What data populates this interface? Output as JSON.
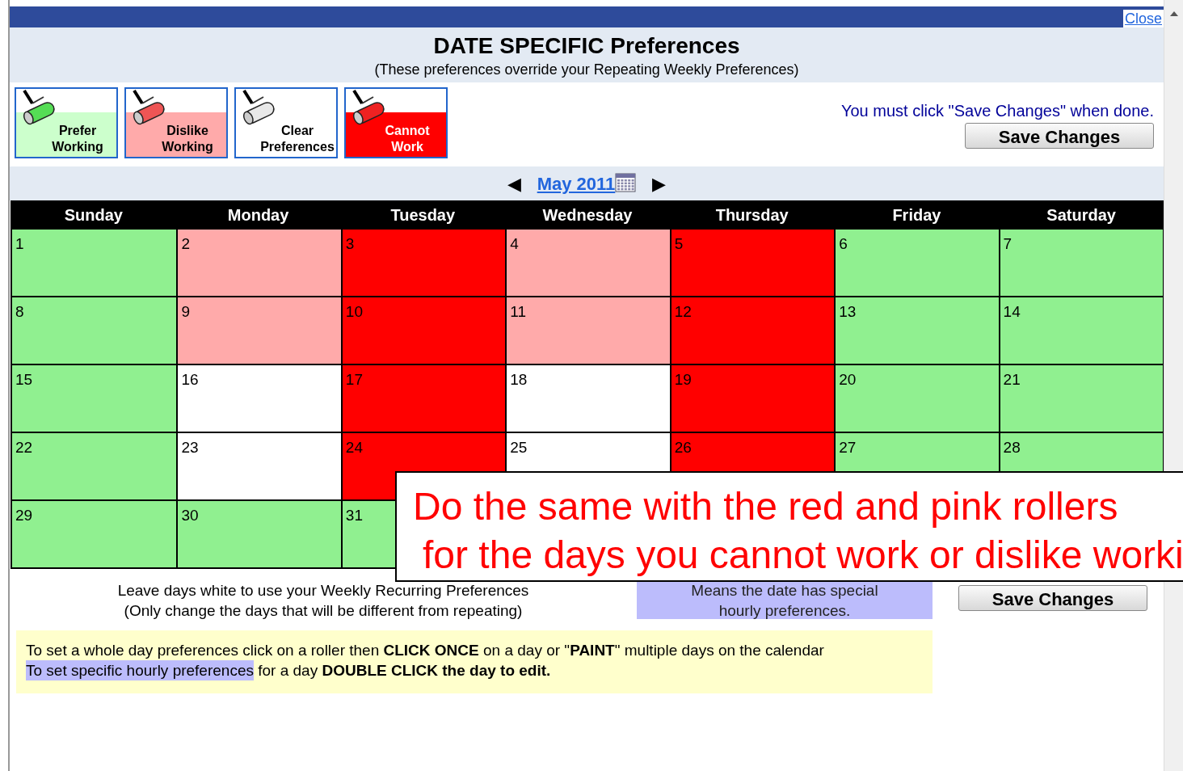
{
  "close_link": "Close",
  "title": "DATE SPECIFIC Preferences",
  "subtitle": "(These preferences override your Repeating Weekly Preferences)",
  "rollers": [
    {
      "kind": "prefer",
      "label": "Prefer Working"
    },
    {
      "kind": "dislike",
      "label": "Dislike Working"
    },
    {
      "kind": "clear",
      "label": "Clear Preferences"
    },
    {
      "kind": "cannot",
      "label": "Cannot Work"
    }
  ],
  "save_hint": "You must click \"Save Changes\" when done.",
  "save_button_top": "Save Changes",
  "month_nav": {
    "prev": "◀",
    "month": "May 2011",
    "next": "▶"
  },
  "weekdays": [
    "Sunday",
    "Monday",
    "Tuesday",
    "Wednesday",
    "Thursday",
    "Friday",
    "Saturday"
  ],
  "weeks": [
    [
      {
        "day": "1",
        "color": "#90f090"
      },
      {
        "day": "2",
        "color": "#ffaaaa"
      },
      {
        "day": "3",
        "color": "#ff0000"
      },
      {
        "day": "4",
        "color": "#ffaaaa"
      },
      {
        "day": "5",
        "color": "#ff0000"
      },
      {
        "day": "6",
        "color": "#90f090"
      },
      {
        "day": "7",
        "color": "#90f090"
      }
    ],
    [
      {
        "day": "8",
        "color": "#90f090"
      },
      {
        "day": "9",
        "color": "#ffaaaa"
      },
      {
        "day": "10",
        "color": "#ff0000"
      },
      {
        "day": "11",
        "color": "#ffaaaa"
      },
      {
        "day": "12",
        "color": "#ff0000"
      },
      {
        "day": "13",
        "color": "#90f090"
      },
      {
        "day": "14",
        "color": "#90f090"
      }
    ],
    [
      {
        "day": "15",
        "color": "#90f090"
      },
      {
        "day": "16",
        "color": "#ffffff"
      },
      {
        "day": "17",
        "color": "#ff0000"
      },
      {
        "day": "18",
        "color": "#ffffff"
      },
      {
        "day": "19",
        "color": "#ff0000"
      },
      {
        "day": "20",
        "color": "#90f090"
      },
      {
        "day": "21",
        "color": "#90f090"
      }
    ],
    [
      {
        "day": "22",
        "color": "#90f090"
      },
      {
        "day": "23",
        "color": "#ffffff"
      },
      {
        "day": "24",
        "color": "#ff0000"
      },
      {
        "day": "25",
        "color": "#ffffff"
      },
      {
        "day": "26",
        "color": "#ff0000"
      },
      {
        "day": "27",
        "color": "#90f090"
      },
      {
        "day": "28",
        "color": "#90f090"
      }
    ],
    [
      {
        "day": "29",
        "color": "#90f090"
      },
      {
        "day": "30",
        "color": "#90f090"
      },
      {
        "day": "31",
        "color": "#90f090"
      }
    ]
  ],
  "legend_white": [
    "Leave days white to use your Weekly Recurring Preferences",
    "(Only change the days that will be different from repeating)"
  ],
  "legend_special": "Means the date has special hourly  preferences.",
  "save_button_bottom": "Save Changes",
  "instructions": [
    "To set a whole day preferences click on a roller then  **CLICK ONCE** on a day or \"**PAINT**\" multiple days on the calendar"
  ],
  "instruction_highlight": "To set specific hourly preferences",
  "instruction_rest": " for a day **DOUBLE CLICK the day to edit.**",
  "callout": [
    "Do the same with the red and pink rollers",
    "for the days you cannot work or dislike worki"
  ]
}
